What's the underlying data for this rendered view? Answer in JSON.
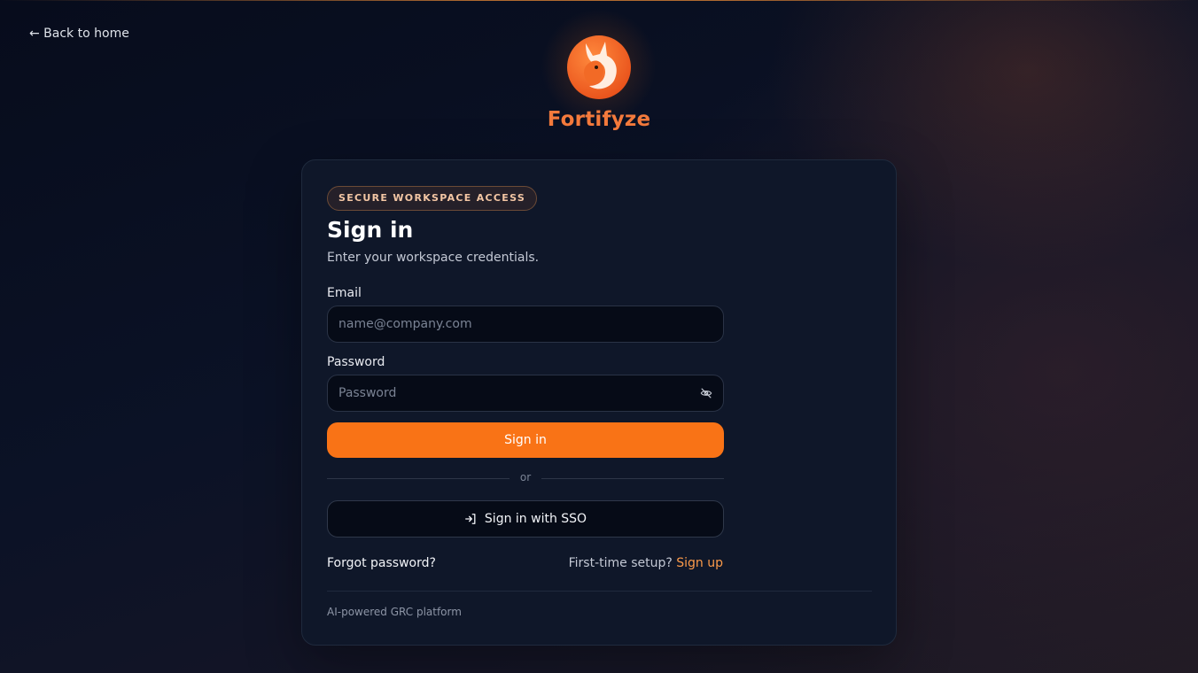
{
  "nav": {
    "back_label": "← Back to home"
  },
  "brand": {
    "name": "Fortifyze",
    "accent": "#f97316",
    "logo_icon": "fox-logo-icon"
  },
  "card": {
    "badge": "SECURE WORKSPACE ACCESS",
    "title": "Sign in",
    "subtitle": "Enter your workspace credentials.",
    "email": {
      "label": "Email",
      "placeholder": "name@company.com",
      "value": ""
    },
    "password": {
      "label": "Password",
      "placeholder": "Password",
      "value": "",
      "toggle_icon": "eye-off-icon"
    },
    "submit_label": "Sign in",
    "divider_label": "or",
    "sso": {
      "label": "Sign in with SSO",
      "icon": "sign-in-arrow-icon"
    },
    "forgot_label": "Forgot password?",
    "setup_prompt": "First-time setup?",
    "signup_label": "Sign up",
    "footer": "AI-powered GRC platform"
  }
}
